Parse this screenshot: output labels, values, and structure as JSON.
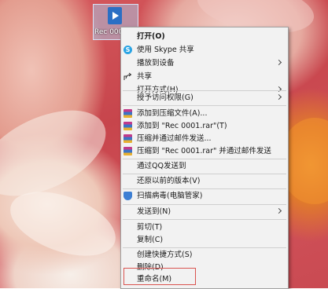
{
  "desktop": {
    "file_name": "Rec 0001"
  },
  "context_menu": {
    "items": [
      {
        "label": "打开(O)",
        "bold": true
      },
      {
        "label": "使用 Skype 共享",
        "icon": "skype-icon"
      },
      {
        "label": "播放到设备",
        "submenu": true
      },
      {
        "label": "共享",
        "icon": "share-icon"
      },
      {
        "label": "打开方式(H)",
        "submenu": true
      },
      {
        "label": "授予访问权限(G)",
        "submenu": true
      },
      {
        "label": "添加到压缩文件(A)...",
        "icon": "winrar-icon"
      },
      {
        "label": "添加到 \"Rec 0001.rar\"(T)",
        "icon": "winrar-icon"
      },
      {
        "label": "压缩并通过邮件发送...",
        "icon": "winrar-icon"
      },
      {
        "label": "压缩到 \"Rec 0001.rar\" 并通过邮件发送",
        "icon": "winrar-icon"
      },
      {
        "label": "通过QQ发送到"
      },
      {
        "label": "还原以前的版本(V)"
      },
      {
        "label": "扫描病毒(电脑管家)",
        "icon": "shield-icon"
      },
      {
        "label": "发送到(N)",
        "submenu": true
      },
      {
        "label": "剪切(T)"
      },
      {
        "label": "复制(C)"
      },
      {
        "label": "创建快捷方式(S)"
      },
      {
        "label": "删除(D)"
      },
      {
        "label": "重命名(M)"
      }
    ]
  },
  "colors": {
    "menu_bg": "#f2f2f2",
    "highlight_border": "#d9534f"
  }
}
